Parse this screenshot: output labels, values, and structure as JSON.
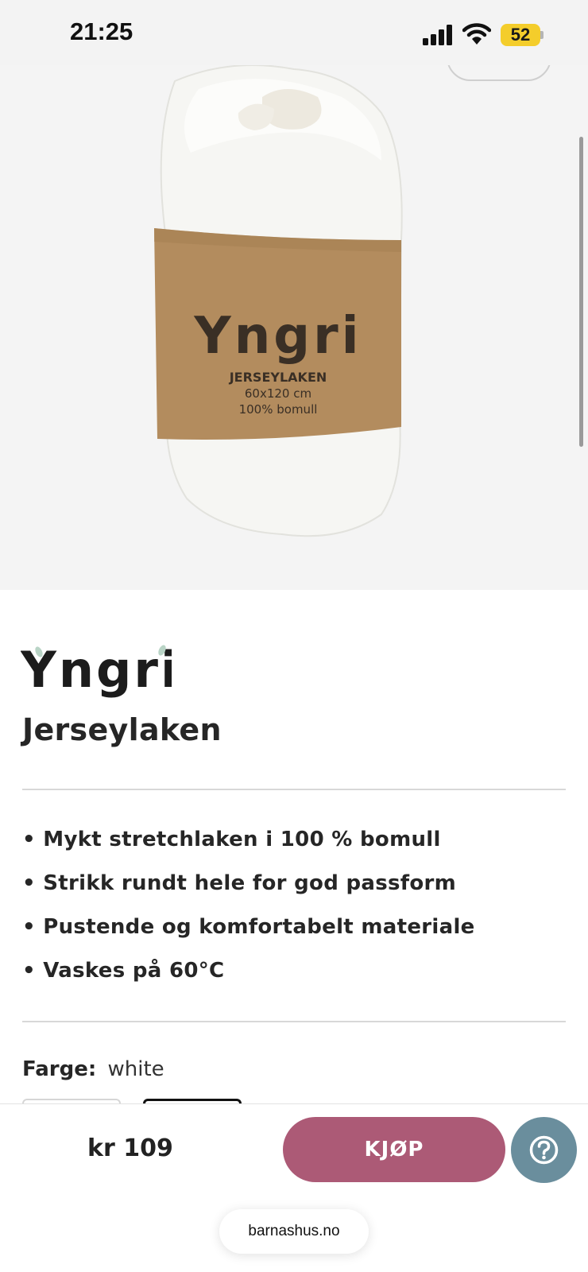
{
  "status_bar": {
    "time": "21:25",
    "battery": "52",
    "icons": [
      "signal-icon",
      "wifi-icon",
      "battery-icon"
    ]
  },
  "product_image": {
    "brand_on_label": "Yngri",
    "label_line1": "JERSEYLAKEN",
    "label_line2": "60x120 cm",
    "label_line3": "100% bomull"
  },
  "product": {
    "brand": "Yngri",
    "title": "Jerseylaken",
    "features": [
      "• Mykt stretchlaken i 100 % bomull",
      "• Strikk rundt hele for god passform",
      "• Pustende og komfortabelt materiale",
      "• Vaskes på 60°C"
    ],
    "color_label": "Farge:",
    "color_value": "white"
  },
  "bottom_bar": {
    "price": "kr 109",
    "buy_label": "KJØP",
    "help_icon": "help-icon",
    "domain": "barnashus.no"
  },
  "colors": {
    "buy_button": "#ac5a76",
    "help_button": "#6a8e9d",
    "battery": "#f4cd2b",
    "label_kraft": "#b38c5e"
  }
}
